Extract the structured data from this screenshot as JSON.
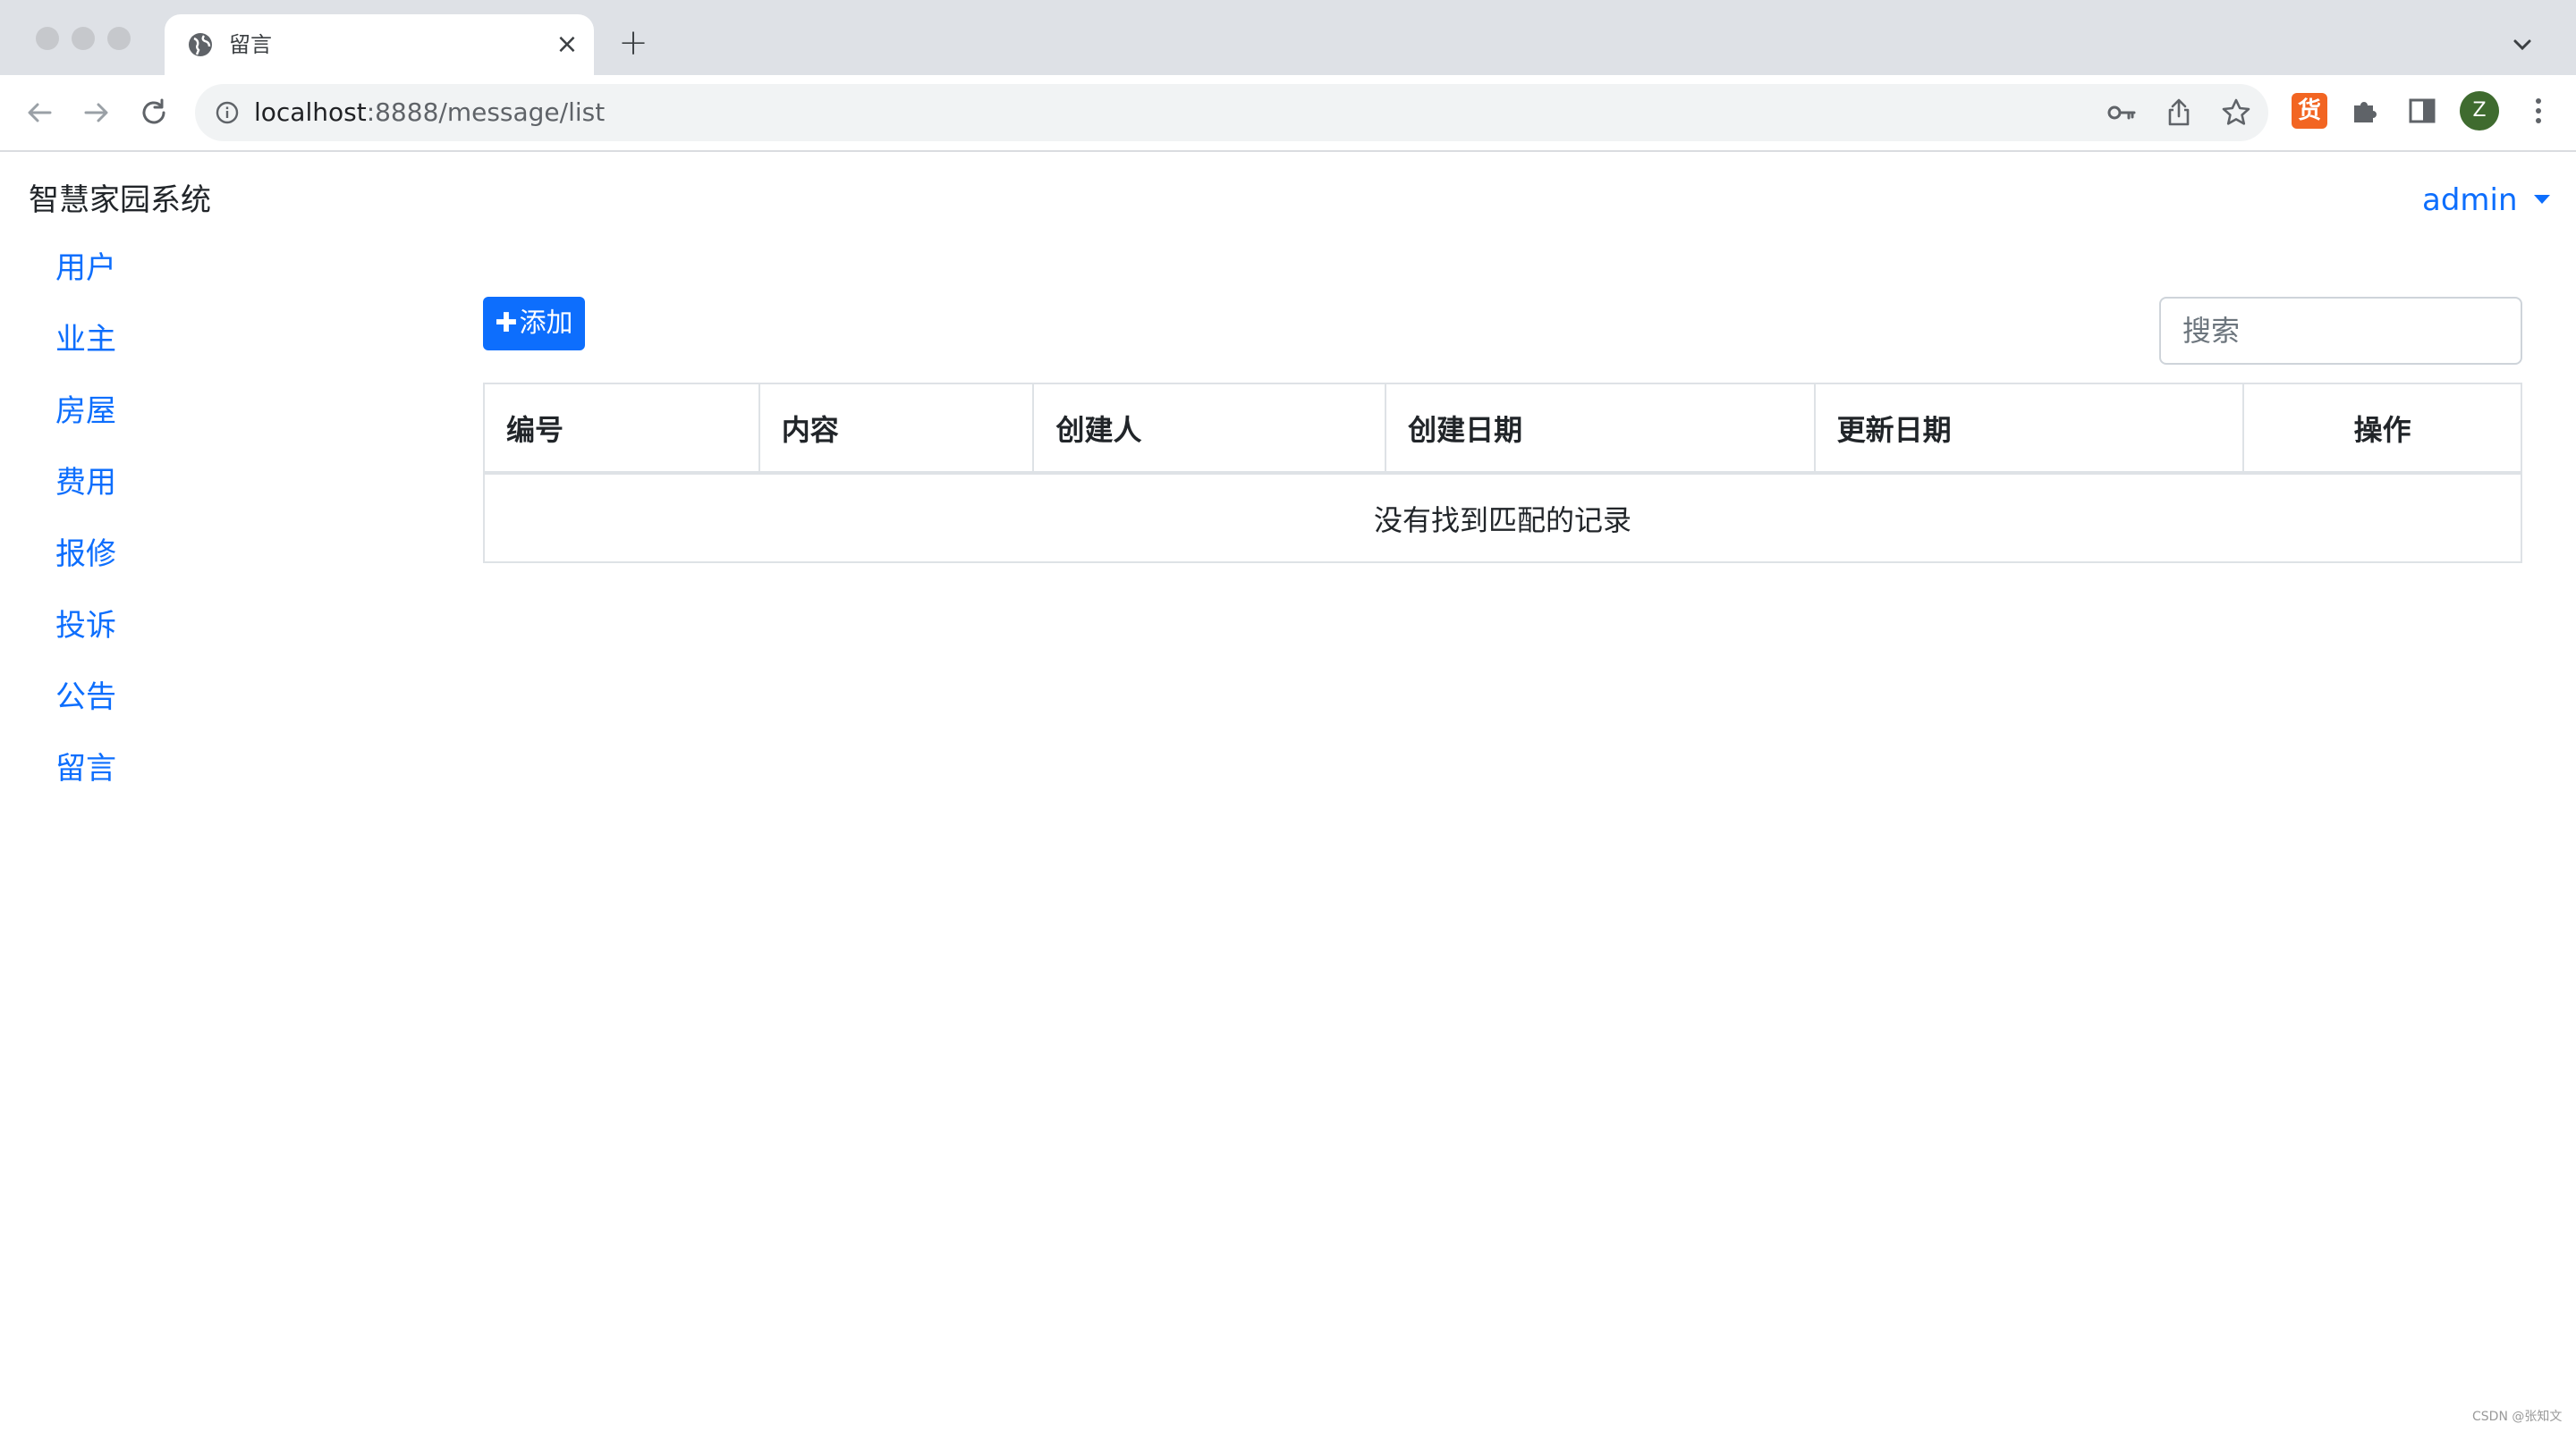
{
  "browser": {
    "tab_title": "留言",
    "tab_close": "×",
    "new_tab": "+",
    "url_host": "localhost",
    "url_rest": ":8888/message/list",
    "extension_badge": "货",
    "profile_initial": "Z"
  },
  "header": {
    "brand": "智慧家园系统",
    "user": "admin"
  },
  "sidebar": {
    "items": [
      {
        "label": "用户"
      },
      {
        "label": "业主"
      },
      {
        "label": "房屋"
      },
      {
        "label": "费用"
      },
      {
        "label": "报修"
      },
      {
        "label": "投诉"
      },
      {
        "label": "公告"
      },
      {
        "label": "留言"
      }
    ]
  },
  "toolbar": {
    "add_plus": "✚",
    "add_label": "添加",
    "search_placeholder": "搜索"
  },
  "table": {
    "columns": [
      "编号",
      "内容",
      "创建人",
      "创建日期",
      "更新日期",
      "操作"
    ],
    "empty_message": "没有找到匹配的记录"
  },
  "watermark": "CSDN @张知文",
  "colors": {
    "primary": "#0d6efd",
    "tabstrip": "#dee1e6",
    "border": "#dee2e6"
  }
}
